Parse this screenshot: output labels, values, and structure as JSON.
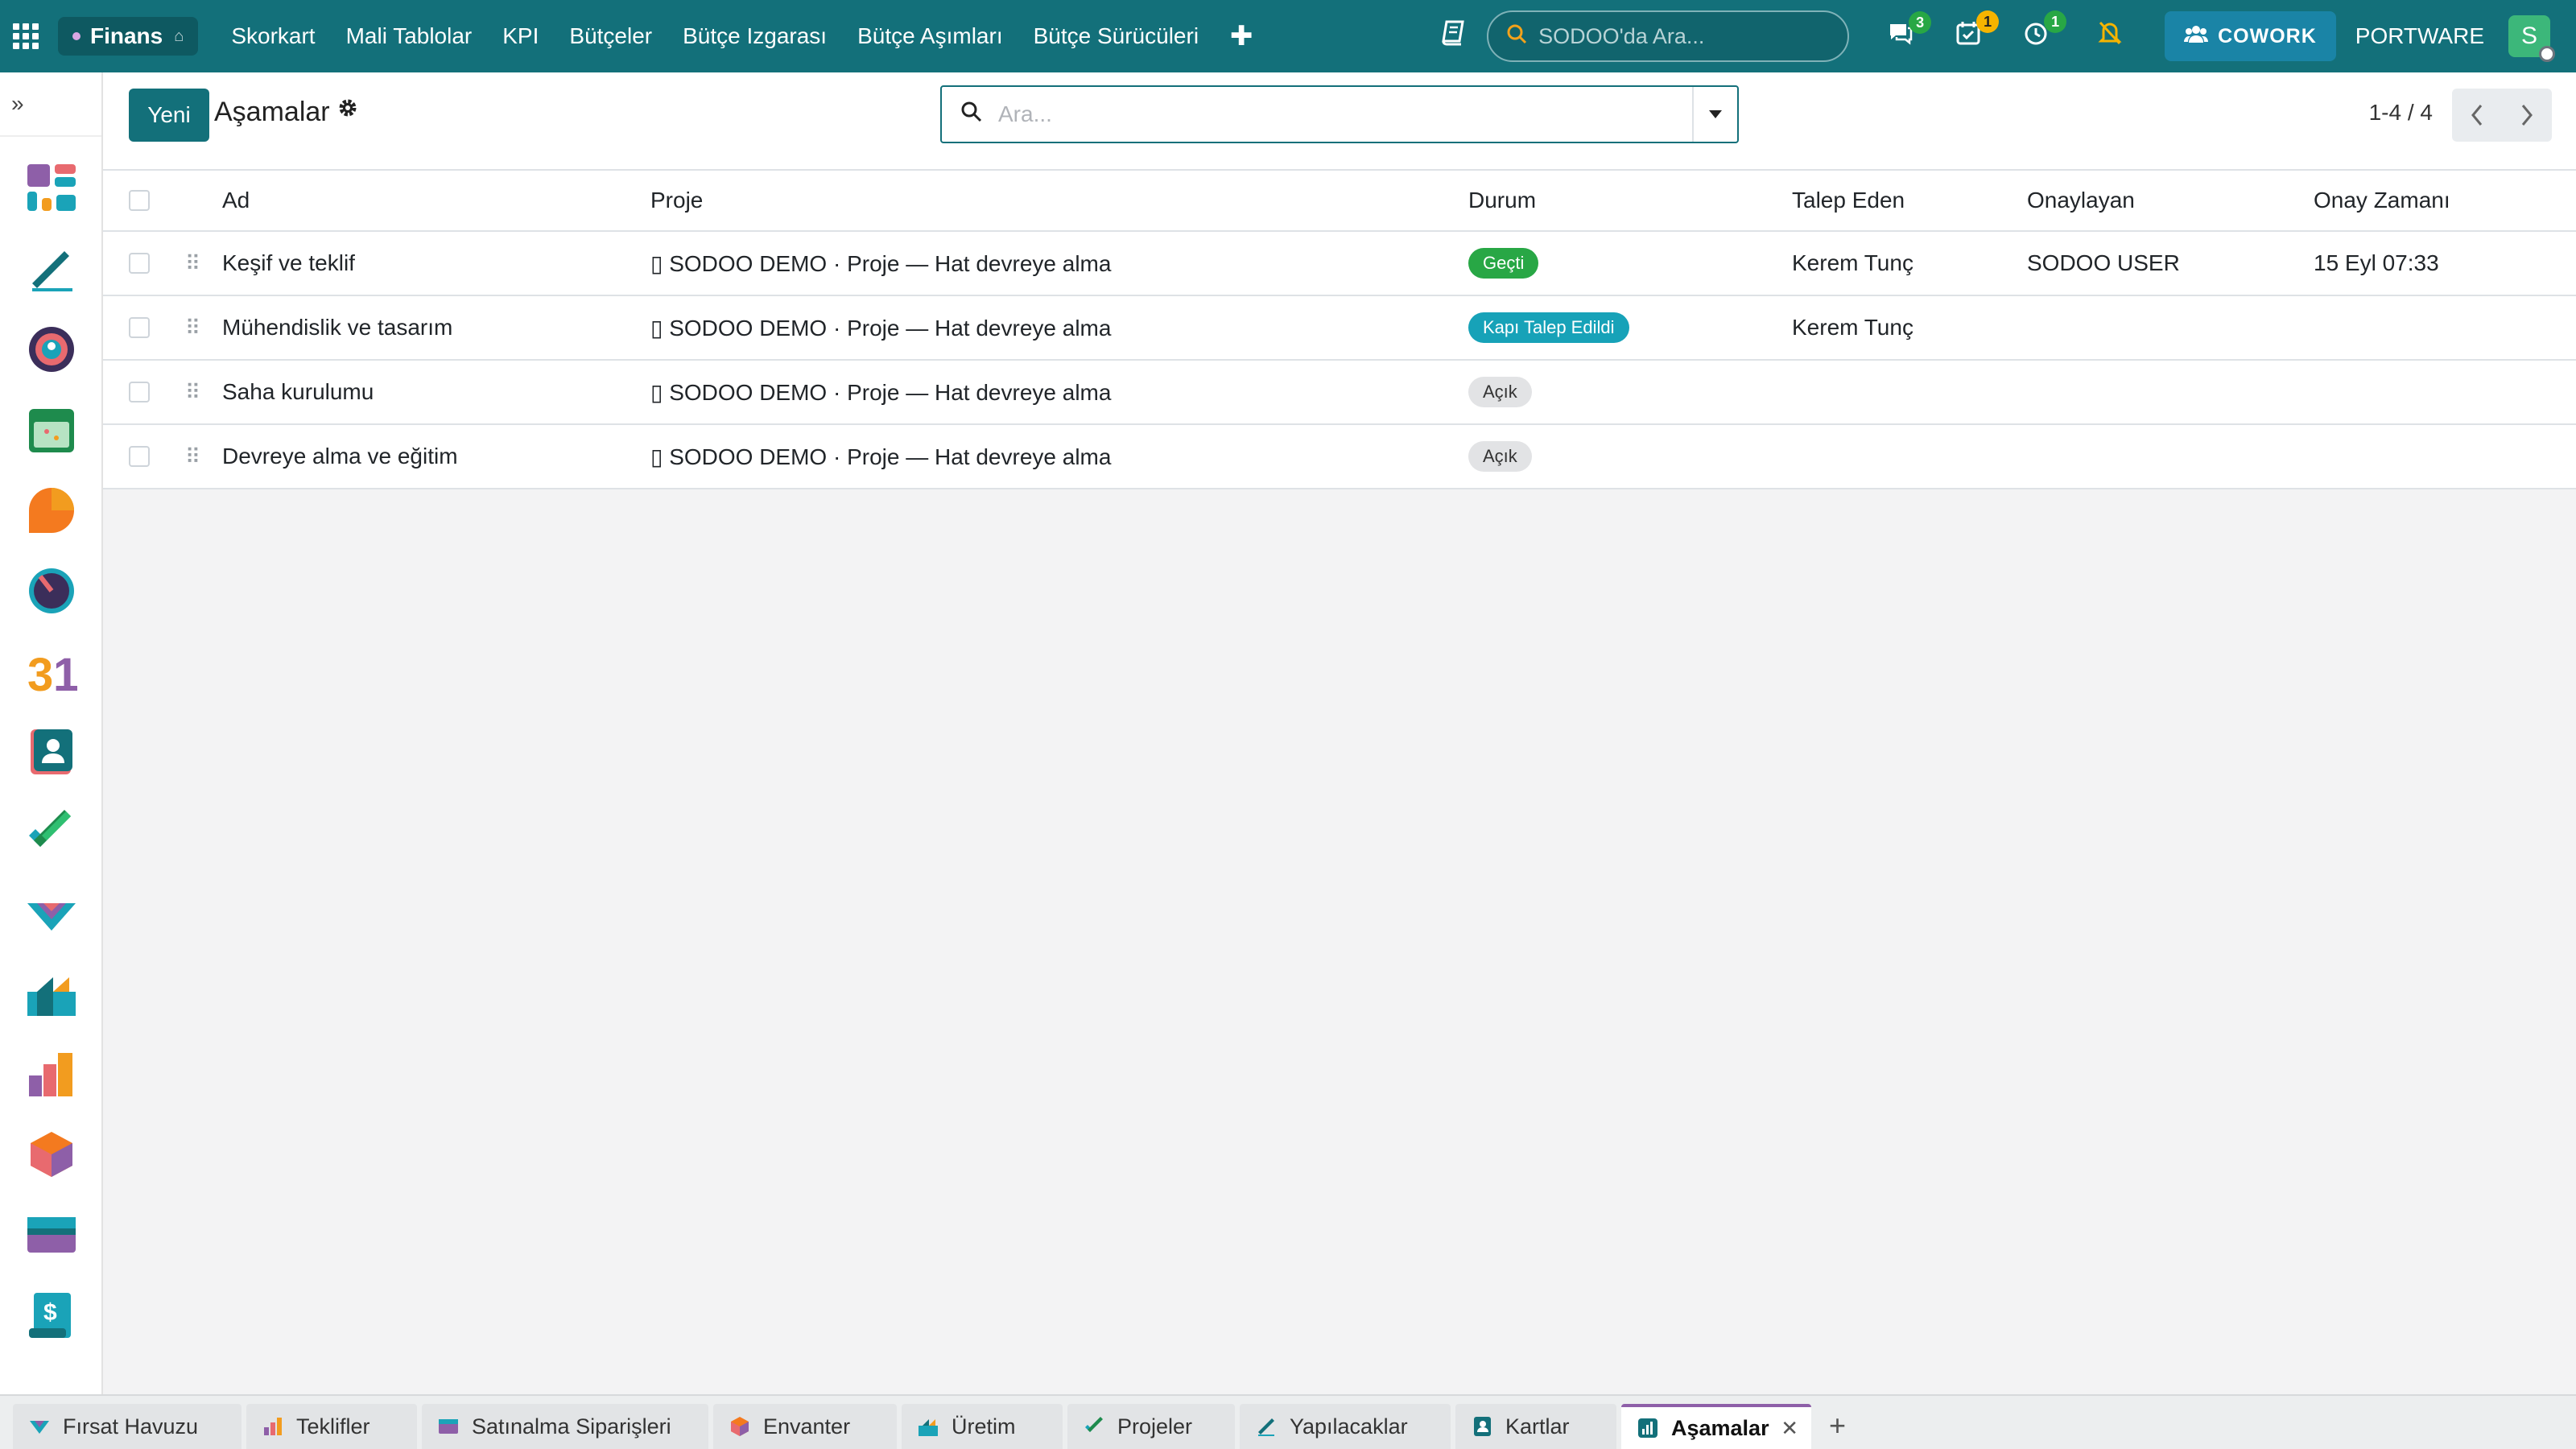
{
  "navbar": {
    "app_name": "Finans",
    "menu": [
      "Skorkart",
      "Mali Tablolar",
      "KPI",
      "Bütçeler",
      "Bütçe Izgarası",
      "Bütçe Aşımları",
      "Bütçe Sürücüleri"
    ],
    "plus": "✚",
    "search_placeholder": "SODOO'da Ara...",
    "messages_count": "3",
    "activities_count": "1",
    "timer_count": "1",
    "cowork_label": "COWORK",
    "company": "PORTWARE",
    "user_initial": "S"
  },
  "control": {
    "new_button": "Yeni",
    "title": "Aşamalar",
    "search_placeholder": "Ara...",
    "pager": "1-4 / 4"
  },
  "table": {
    "columns": [
      "Ad",
      "Proje",
      "Durum",
      "Talep Eden",
      "Onaylayan",
      "Onay Zamanı"
    ],
    "rows": [
      {
        "name": "Keşif ve teklif",
        "project": "▯ SODOO DEMO · Proje — Hat devreye alma",
        "status": "Geçti",
        "requested_by": "Kerem Tunç",
        "approved_by": "SODOO USER",
        "approved_at": "15 Eyl 07:33"
      },
      {
        "name": "Mühendislik ve tasarım",
        "project": "▯ SODOO DEMO · Proje — Hat devreye alma",
        "status": "Kapı Talep Edildi",
        "requested_by": "Kerem Tunç",
        "approved_by": "",
        "approved_at": ""
      },
      {
        "name": "Saha kurulumu",
        "project": "▯ SODOO DEMO · Proje — Hat devreye alma",
        "status": "Açık",
        "requested_by": "",
        "approved_by": "",
        "approved_at": ""
      },
      {
        "name": "Devreye alma ve eğitim",
        "project": "▯ SODOO DEMO · Proje — Hat devreye alma",
        "status": "Açık",
        "requested_by": "",
        "approved_by": "",
        "approved_at": ""
      }
    ]
  },
  "tabs": [
    {
      "label": "Fırsat Havuzu"
    },
    {
      "label": "Teklifler"
    },
    {
      "label": "Satınalma Siparişleri"
    },
    {
      "label": "Envanter"
    },
    {
      "label": "Üretim"
    },
    {
      "label": "Projeler"
    },
    {
      "label": "Yapılacaklar"
    },
    {
      "label": "Kartlar"
    },
    {
      "label": "Aşamalar"
    }
  ],
  "colors": {
    "brand": "#13707a",
    "status_green": "#28a745",
    "status_teal": "#17a2b8",
    "status_grey": "#e2e3e5"
  }
}
